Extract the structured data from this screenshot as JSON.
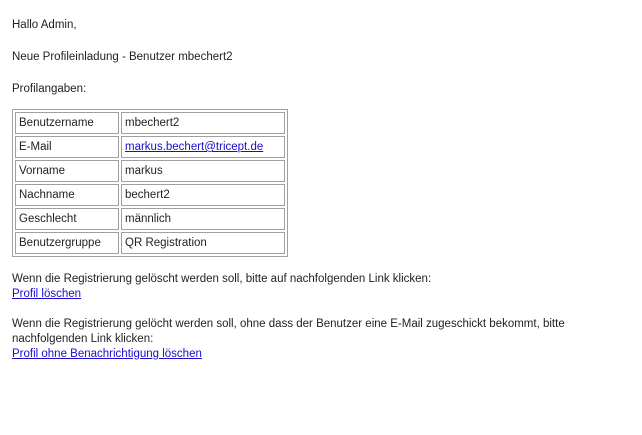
{
  "email": {
    "greeting": "Hallo Admin,",
    "intro": "Neue Profileinladung - Benutzer mbechert2",
    "profile_label": "Profilangaben:",
    "profile_rows": [
      {
        "key": "Benutzername",
        "value": "mbechert2"
      },
      {
        "key": "E-Mail",
        "value": "markus.bechert@tricept.de",
        "is_link": true
      },
      {
        "key": "Vorname",
        "value": "markus"
      },
      {
        "key": "Nachname",
        "value": "bechert2"
      },
      {
        "key": "Geschlecht",
        "value": "männlich"
      },
      {
        "key": "Benutzergruppe",
        "value": "QR Registration"
      }
    ],
    "delete_text": "Wenn die Registrierung gelöscht werden soll, bitte auf nachfolgenden Link klicken:",
    "delete_link": "Profil löschen",
    "delete_silent_text": "Wenn die Registrierung gelöcht werden soll, ohne dass der Benutzer eine E-Mail zugeschickt bekommt, bitte nachfolgenden Link klicken:",
    "delete_silent_link": "Profil ohne Benachrichtigung löschen"
  },
  "colors": {
    "link": "#1a0dcc",
    "text": "#1f1f1f",
    "table_border": "#a0a0a0"
  }
}
